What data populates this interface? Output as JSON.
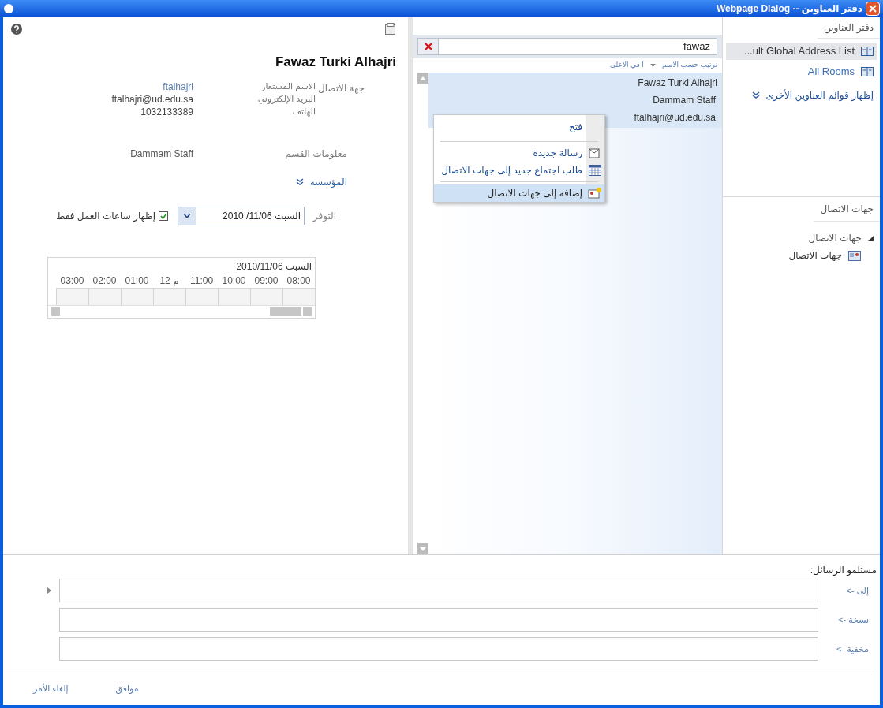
{
  "window": {
    "title": "دفتر العناوين -- Webpage Dialog"
  },
  "address_books": {
    "title": "دفتر العناوين",
    "items": [
      {
        "label": "...ult Global Address List",
        "selected": true
      },
      {
        "label": "All Rooms",
        "selected": false
      }
    ],
    "more_link": "إظهار قوائم العناوين الأخرى"
  },
  "contacts": {
    "title": "جهات الاتصال",
    "tree": [
      {
        "label": "جهات الاتصال",
        "expanded": true,
        "children": [
          {
            "label": "جهات الاتصال"
          }
        ]
      }
    ]
  },
  "search": {
    "value": "fawaz"
  },
  "sort": {
    "by": "ترتيب حسب الاسم",
    "order": "آ في الأعلى"
  },
  "results": [
    {
      "lines": [
        "Fawaz Turki Alhajri",
        "Dammam Staff",
        "ftalhajri@ud.edu.sa"
      ],
      "selected": true
    }
  ],
  "context_menu": [
    {
      "kind": "item",
      "label": "فتح",
      "selected": false
    },
    {
      "kind": "separator"
    },
    {
      "kind": "item",
      "label": "رسالة جديدة",
      "selected": false
    },
    {
      "kind": "item",
      "label": "طلب اجتماع جديد إلى جهات الاتصال",
      "selected": false
    },
    {
      "kind": "separator"
    },
    {
      "kind": "item",
      "label": "إضافة إلى جهات الاتصال",
      "selected": true
    }
  ],
  "details": {
    "name": "Fawaz Turki Alhajri",
    "section_label": "جهة الاتصال",
    "fields": [
      {
        "label": "الاسم المستعار",
        "value": "ftalhajri",
        "link": true
      },
      {
        "label": "البريد الإلكتروني",
        "value": "ftalhajri@ud.edu.sa",
        "link": false
      },
      {
        "label": "الهاتف",
        "value": "1032133389",
        "link": false
      }
    ],
    "department": {
      "label": "معلومات القسم",
      "value": "Dammam Staff"
    },
    "organization_link": "المؤسسة",
    "availability": {
      "label": "التوفر",
      "date": "السبت 11/06/ 2010",
      "working_hours_only": {
        "label": "إظهار ساعات العمل فقط",
        "checked": true
      }
    },
    "schedule": {
      "date": "السبت 2010/11/06",
      "hours": [
        "08:00",
        "09:00",
        "10:00",
        "11:00",
        "12 م",
        "01:00",
        "02:00",
        "03:00"
      ]
    }
  },
  "recipients": {
    "title": "مستلمو الرسائل:",
    "rows": [
      {
        "label": "إلى ->",
        "active": true
      },
      {
        "label": "نسخة ->",
        "active": false
      },
      {
        "label": "مخفية ->",
        "active": false
      }
    ]
  },
  "buttons": [
    "موافق",
    "إلغاء الأمر"
  ]
}
